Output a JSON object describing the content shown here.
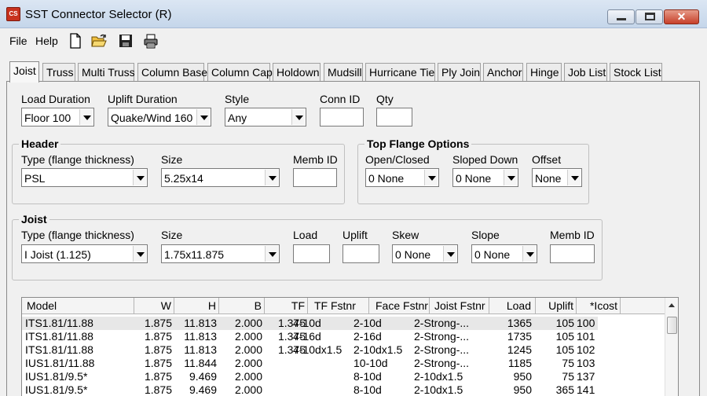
{
  "window": {
    "title": "SST Connector Selector (R)",
    "icon_text": "CS",
    "close_glyph": "✕"
  },
  "menu": {
    "file": "File",
    "help": "Help"
  },
  "toolbar_icons": [
    "new-file-icon",
    "open-folder-icon",
    "save-disk-icon",
    "print-icon"
  ],
  "tabs": [
    {
      "label": "Joist",
      "active": true
    },
    {
      "label": "Truss"
    },
    {
      "label": "Multi Truss"
    },
    {
      "label": "Column Base"
    },
    {
      "label": "Column Cap"
    },
    {
      "label": "Holdown"
    },
    {
      "label": "Mudsill"
    },
    {
      "label": "Hurricane Tie"
    },
    {
      "label": "Ply Join"
    },
    {
      "label": "Anchor"
    },
    {
      "label": "Hinge"
    },
    {
      "label": "Job List"
    },
    {
      "label": "Stock List"
    }
  ],
  "top": {
    "load_duration": {
      "label": "Load Duration",
      "value": "Floor 100"
    },
    "uplift_duration": {
      "label": "Uplift Duration",
      "value": "Quake/Wind 160"
    },
    "style": {
      "label": "Style",
      "value": "Any"
    },
    "conn_id": {
      "label": "Conn ID",
      "value": ""
    },
    "qty": {
      "label": "Qty",
      "value": ""
    }
  },
  "header": {
    "title": "Header",
    "type": {
      "label": "Type (flange thickness)",
      "value": "PSL"
    },
    "size": {
      "label": "Size",
      "value": "5.25x14"
    },
    "memb_id": {
      "label": "Memb ID",
      "value": ""
    }
  },
  "top_flange": {
    "title": "Top Flange Options",
    "open_closed": {
      "label": "Open/Closed",
      "value": "0 None"
    },
    "sloped_down": {
      "label": "Sloped Down",
      "value": "0 None"
    },
    "offset": {
      "label": "Offset",
      "value": "None"
    }
  },
  "joist": {
    "title": "Joist",
    "type": {
      "label": "Type (flange thickness)",
      "value": "I Joist (1.125)"
    },
    "size": {
      "label": "Size",
      "value": "1.75x11.875"
    },
    "load": {
      "label": "Load",
      "value": ""
    },
    "uplift": {
      "label": "Uplift",
      "value": ""
    },
    "skew": {
      "label": "Skew",
      "value": "0 None"
    },
    "slope": {
      "label": "Slope",
      "value": "0 None"
    },
    "memb_id": {
      "label": "Memb ID",
      "value": ""
    }
  },
  "results": {
    "columns": [
      "Model",
      "W",
      "H",
      "B",
      "TF",
      "TF Fstnr",
      "Face Fstnr",
      "Joist Fstnr",
      "Load",
      "Uplift",
      "*Icost"
    ],
    "rows": [
      [
        "ITS1.81/11.88",
        "1.875",
        "11.813",
        "2.000",
        "1.375",
        "4-10d",
        "2-10d",
        "2-Strong-...",
        "1365",
        "105",
        "100"
      ],
      [
        "ITS1.81/11.88",
        "1.875",
        "11.813",
        "2.000",
        "1.375",
        "4-16d",
        "2-16d",
        "2-Strong-...",
        "1735",
        "105",
        "101"
      ],
      [
        "ITS1.81/11.88",
        "1.875",
        "11.813",
        "2.000",
        "1.375",
        "4-10dx1.5",
        "2-10dx1.5",
        "2-Strong-...",
        "1245",
        "105",
        "102"
      ],
      [
        "IUS1.81/11.88",
        "1.875",
        "11.844",
        "2.000",
        "",
        "",
        "10-10d",
        "2-Strong-...",
        "1185",
        "75",
        "103"
      ],
      [
        "IUS1.81/9.5*",
        "1.875",
        "9.469",
        "2.000",
        "",
        "",
        "8-10d",
        "2-10dx1.5",
        "950",
        "75",
        "137"
      ],
      [
        "IUS1.81/9.5*",
        "1.875",
        "9.469",
        "2.000",
        "",
        "",
        "8-10d",
        "2-10dx1.5",
        "950",
        "365",
        "141"
      ]
    ]
  }
}
